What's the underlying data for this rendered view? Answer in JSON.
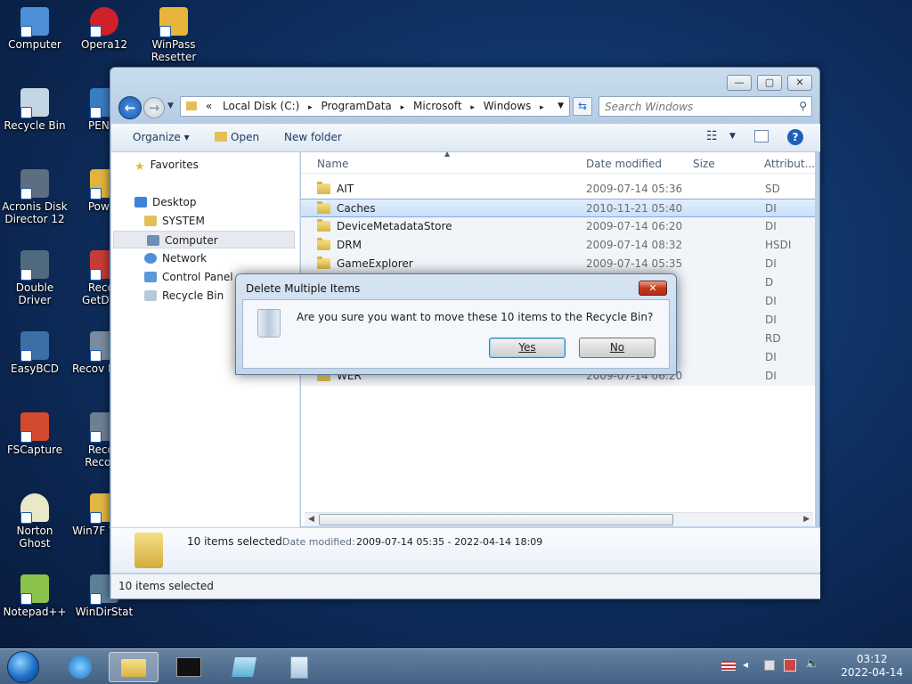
{
  "desktop": {
    "icons": [
      {
        "label": "Computer",
        "color": "#4d8fd6"
      },
      {
        "label": "Opera12",
        "color": "#d0202a"
      },
      {
        "label": "WinPass Resetter",
        "color": "#e7b53a"
      },
      {
        "label": "Recycle Bin",
        "color": "#c4d6e4"
      },
      {
        "label": "PENet",
        "color": "#3a7cc2"
      },
      {
        "label": "Acronis Disk Director 12",
        "color": "#5c6e80"
      },
      {
        "label": "Power",
        "color": "#e1b43e"
      },
      {
        "label": "Double Driver",
        "color": "#4f6a7e"
      },
      {
        "label": "Recov GetData",
        "color": "#c63b36"
      },
      {
        "label": "EasyBCD",
        "color": "#3c6fa8"
      },
      {
        "label": "Recov MiniT",
        "color": "#7a8ca0"
      },
      {
        "label": "FSCapture",
        "color": "#d34a2e"
      },
      {
        "label": "Recov Recove",
        "color": "#6d7f93"
      },
      {
        "label": "Norton Ghost",
        "color": "#e9e9c8"
      },
      {
        "label": "Win7F Warn",
        "color": "#e2b643"
      },
      {
        "label": "Notepad++",
        "color": "#8ac24b"
      },
      {
        "label": "WinDirStat",
        "color": "#5e7f98"
      }
    ]
  },
  "window": {
    "controls": {
      "minimize": "—",
      "maximize": "▢",
      "close": "✕"
    },
    "address": {
      "overflow": "«",
      "crumbs": [
        "Local Disk (C:)",
        "ProgramData",
        "Microsoft",
        "Windows"
      ],
      "sep": "▸"
    },
    "search": {
      "placeholder": "Search Windows"
    },
    "toolbar": {
      "organize": "Organize ▾",
      "open": "Open",
      "new_folder": "New folder"
    },
    "nav": {
      "favorites": "Favorites",
      "desktop": "Desktop",
      "system": "SYSTEM",
      "computer": "Computer",
      "network": "Network",
      "control_panel": "Control Panel",
      "recycle_bin": "Recycle Bin"
    },
    "columns": {
      "name": "Name",
      "date": "Date modified",
      "size": "Size",
      "attr": "Attribut..."
    },
    "rows": [
      {
        "name": "AIT",
        "date": "2009-07-14 05:36",
        "attr": "SD"
      },
      {
        "name": "Caches",
        "date": "2010-11-21 05:40",
        "attr": "DI"
      },
      {
        "name": "DeviceMetadataStore",
        "date": "2009-07-14 06:20",
        "attr": "DI"
      },
      {
        "name": "DRM",
        "date": "2009-07-14 08:32",
        "attr": "HSDI"
      },
      {
        "name": "GameExplorer",
        "date": "2009-07-14 05:35",
        "attr": "DI"
      },
      {
        "name": "",
        "date": "",
        "attr": "D"
      },
      {
        "name": "",
        "date": "",
        "attr": "DI"
      },
      {
        "name": "",
        "date": "",
        "attr": "DI"
      },
      {
        "name": "",
        "date": "",
        "attr": "RD"
      },
      {
        "name": "",
        "date": "",
        "attr": "DI"
      },
      {
        "name": "WER",
        "date": "2009-07-14 06:20",
        "attr": "DI"
      }
    ],
    "details": {
      "count": "10 items selected",
      "date_label": "Date modified:",
      "date_range": "2009-07-14 05:35 - 2022-04-14 18:09"
    },
    "status": "10 items selected"
  },
  "dialog": {
    "title": "Delete Multiple Items",
    "close": "✕",
    "message": "Are you sure you want to move these 10 items to the Recycle Bin?",
    "yes": "Yes",
    "no": "No"
  },
  "taskbar": {
    "time": "03:12",
    "date": "2022-04-14"
  }
}
